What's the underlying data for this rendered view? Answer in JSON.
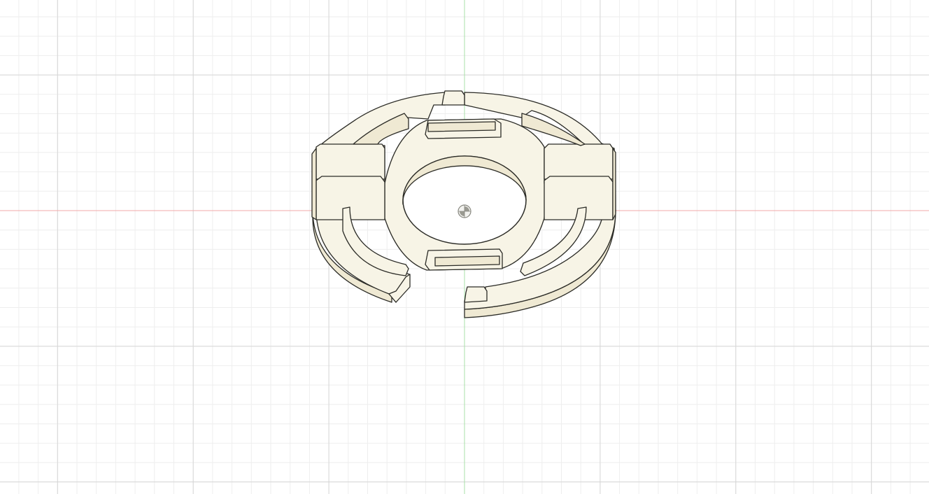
{
  "viewport": {
    "background": "#ffffff",
    "grid_minor_color": "#eeeeee",
    "grid_major_color": "#d6d6d6",
    "x_axis_color": "#f2a8a8",
    "y_axis_color": "#a8e0a8"
  },
  "model": {
    "name_icon": "ring-bracket-part",
    "face_color": "#f7f4e6",
    "side_color": "#efe9d3",
    "edge_color": "#2b2b26"
  },
  "origin": {
    "icon": "origin-marker-icon"
  }
}
